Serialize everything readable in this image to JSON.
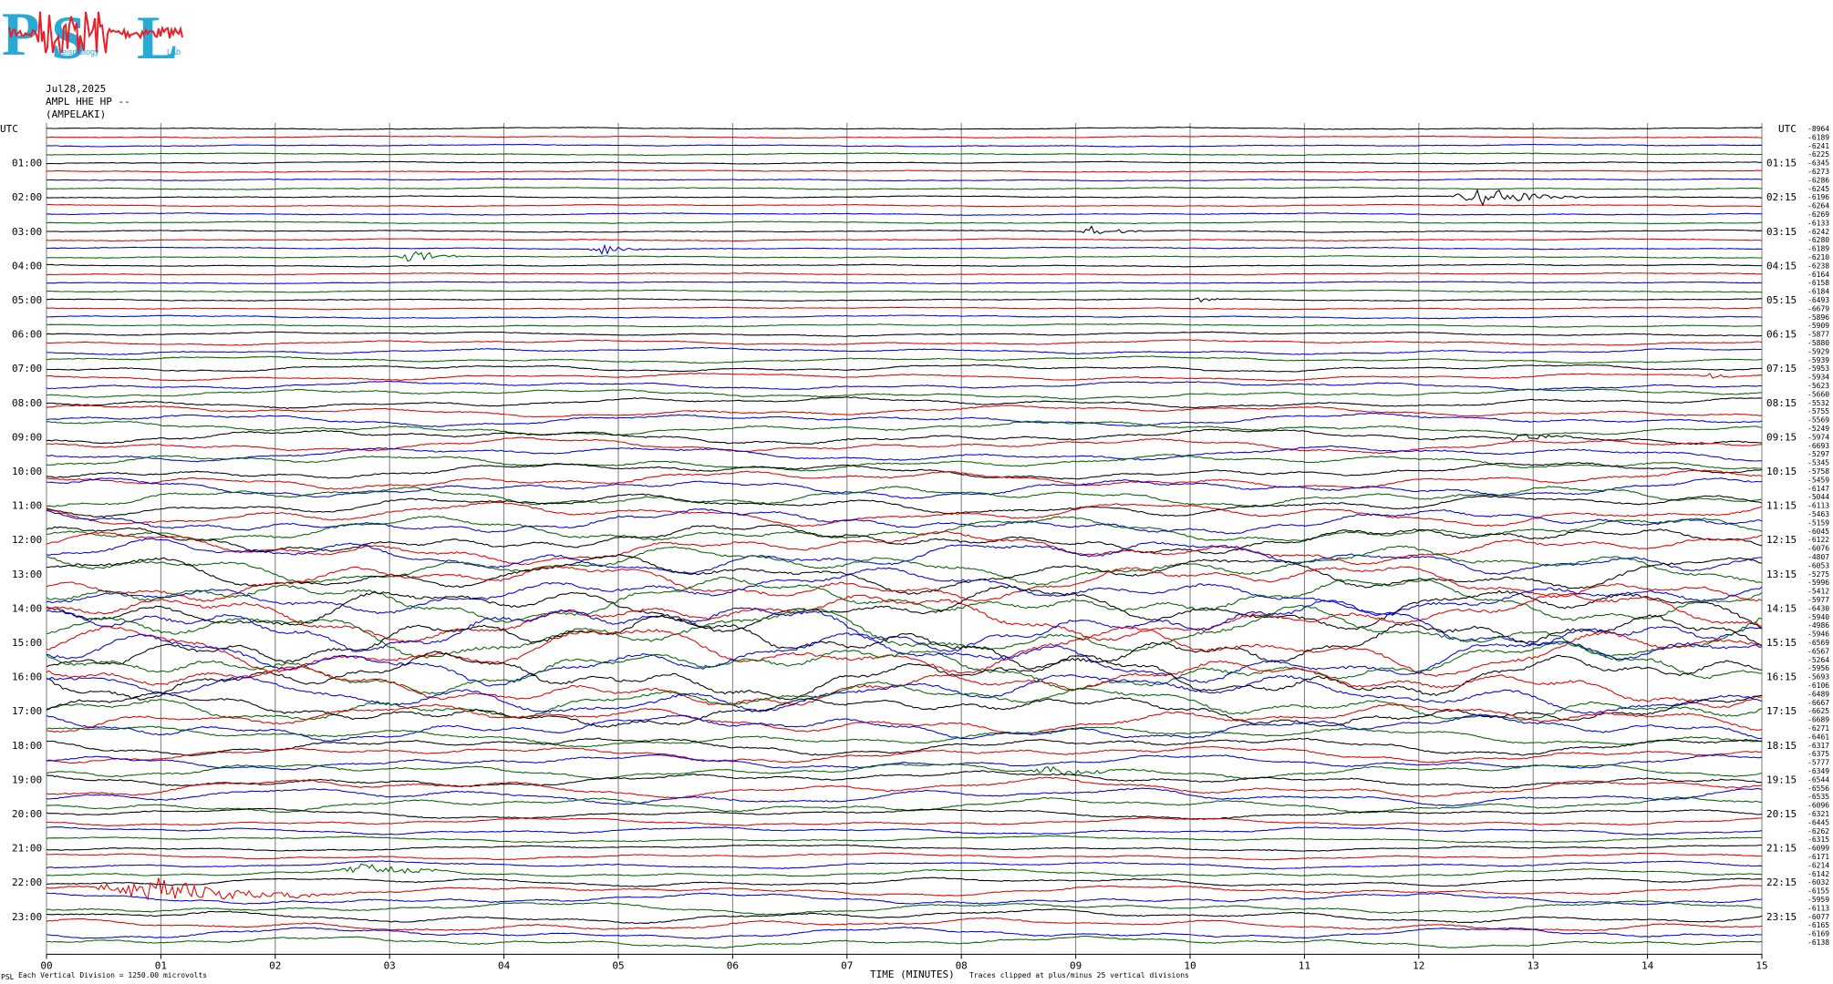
{
  "logo": {
    "letters": [
      "P",
      "S",
      "L"
    ],
    "text_seismology": "Seismology",
    "text_lab": "Lab",
    "colors": {
      "letters": "#29a9d6",
      "trace": "#e8202a",
      "text": "#29a9d6"
    }
  },
  "header": {
    "date": "Jul28,2025",
    "station_line": "AMPL HHE HP --",
    "station_name": "(AMPELAKI)"
  },
  "left_axis_title": "UTC",
  "right_axis_title": "UTC",
  "footer": {
    "scale_note": "Each Vertical Division = 1250.00 microvolts",
    "x_title": "TIME (MINUTES)",
    "clip_note": "Traces clipped at plus/minus 25 vertical divisions",
    "corner_mark": "PSL"
  },
  "colors": {
    "cycle": [
      "#000000",
      "#e00000",
      "#0000e0",
      "#006400"
    ],
    "grid": "#7a7a7a"
  },
  "chart_data": {
    "type": "line",
    "title": "AMPL HHE HP --",
    "xlabel": "TIME (MINUTES)",
    "xlim": [
      0,
      15
    ],
    "x_tick_labels": [
      "00",
      "01",
      "02",
      "03",
      "04",
      "05",
      "06",
      "07",
      "08",
      "09",
      "10",
      "11",
      "12",
      "13",
      "14",
      "15"
    ],
    "left_hour_labels": [
      "UTC",
      "01:00",
      "02:00",
      "03:00",
      "04:00",
      "05:00",
      "06:00",
      "07:00",
      "08:00",
      "09:00",
      "10:00",
      "11:00",
      "12:00",
      "13:00",
      "14:00",
      "15:00",
      "16:00",
      "17:00",
      "18:00",
      "19:00",
      "20:00",
      "21:00",
      "22:00",
      "23:00"
    ],
    "right_hour_labels": [
      "UTC",
      "01:15",
      "02:15",
      "03:15",
      "04:15",
      "05:15",
      "06:15",
      "07:15",
      "08:15",
      "09:15",
      "10:15",
      "11:15",
      "12:15",
      "13:15",
      "14:15",
      "15:15",
      "16:15",
      "17:15",
      "18:15",
      "19:15",
      "20:15",
      "21:15",
      "22:15",
      "23:15"
    ],
    "row_minutes": 15,
    "rows_per_hour": 4,
    "trace_mean_counts": [
      "-8964",
      "-6189",
      "-6241",
      "-6225",
      "-6345",
      "-6273",
      "-6286",
      "-6245",
      "-6196",
      "-6264",
      "-6269",
      "-6133",
      "-6242",
      "-6280",
      "-6189",
      "-6210",
      "-6238",
      "-6164",
      "-6158",
      "-6184",
      "-6493",
      "-6679",
      "-5896",
      "-5909",
      "-5877",
      "-5880",
      "-5929",
      "-5939",
      "-5953",
      "-5934",
      "-5623",
      "-5660",
      "-5532",
      "-5755",
      "-5569",
      "-5249",
      "-5974",
      "-6693",
      "-5297",
      "-5345",
      "-5758",
      "-5459",
      "-6147",
      "-5044",
      "-6113",
      "-5463",
      "-5159",
      "-6045",
      "-6122",
      "-6076",
      "-4807",
      "-6053",
      "-5275",
      "-5996",
      "-5412",
      "-5977",
      "-6430",
      "-5940",
      "-4986",
      "-5946",
      "-6569",
      "-6567",
      "-5264",
      "-5956",
      "-5693",
      "-6106",
      "-6489",
      "-6667",
      "-6625",
      "-6689",
      "-6271",
      "-6461",
      "-6317",
      "-6375",
      "-5777",
      "-6349",
      "-6544",
      "-6556",
      "-6535",
      "-6096",
      "-6321",
      "-6445",
      "-6262",
      "-6315",
      "-6099",
      "-6171",
      "-6214",
      "-6142",
      "-6032",
      "-6155",
      "-5959",
      "-6113",
      "-6077",
      "-6165",
      "-6169",
      "-6138"
    ],
    "row_activity": [
      0.2,
      0.2,
      0.2,
      0.2,
      0.2,
      0.2,
      0.2,
      0.2,
      0.2,
      0.2,
      0.2,
      0.2,
      0.2,
      0.2,
      0.2,
      0.2,
      0.2,
      0.2,
      0.2,
      0.2,
      0.2,
      0.2,
      0.3,
      0.3,
      0.4,
      0.5,
      0.6,
      0.6,
      0.7,
      0.7,
      0.8,
      0.9,
      1.0,
      1.1,
      1.2,
      1.3,
      1.4,
      1.4,
      1.5,
      1.5,
      1.6,
      1.7,
      1.8,
      1.9,
      2.0,
      2.2,
      2.4,
      2.6,
      2.8,
      3.0,
      3.2,
      3.4,
      3.6,
      3.8,
      4.0,
      4.2,
      4.4,
      4.6,
      4.8,
      5.0,
      5.0,
      4.8,
      4.6,
      4.5,
      4.4,
      4.2,
      4.0,
      3.6,
      3.2,
      2.8,
      2.4,
      2.0,
      1.8,
      1.6,
      1.4,
      1.4,
      1.5,
      1.8,
      1.6,
      1.4,
      1.0,
      0.8,
      0.7,
      0.6,
      0.6,
      0.6,
      0.7,
      0.8,
      0.9,
      1.0,
      1.1,
      1.2,
      1.3,
      1.2,
      1.1,
      1.0
    ],
    "events": [
      {
        "row": 8,
        "minute": 12.55,
        "amp": 10,
        "dur": 1.0
      },
      {
        "row": 12,
        "minute": 9.15,
        "amp": 7,
        "dur": 0.5
      },
      {
        "row": 14,
        "minute": 4.85,
        "amp": 7,
        "dur": 0.4
      },
      {
        "row": 15,
        "minute": 3.2,
        "amp": 9,
        "dur": 0.5
      },
      {
        "row": 20,
        "minute": 10.1,
        "amp": 4,
        "dur": 0.3
      },
      {
        "row": 21,
        "minute": 14.6,
        "amp": 7,
        "dur": 0.1
      },
      {
        "row": 29,
        "minute": 14.5,
        "amp": 6,
        "dur": 0.3
      },
      {
        "row": 36,
        "minute": 12.9,
        "amp": 6,
        "dur": 0.5
      },
      {
        "row": 75,
        "minute": 8.8,
        "amp": 5,
        "dur": 1.0
      },
      {
        "row": 87,
        "minute": 2.8,
        "amp": 9,
        "dur": 0.8
      },
      {
        "row": 89,
        "minute": 0.9,
        "amp": 14,
        "dur": 1.8
      }
    ]
  }
}
